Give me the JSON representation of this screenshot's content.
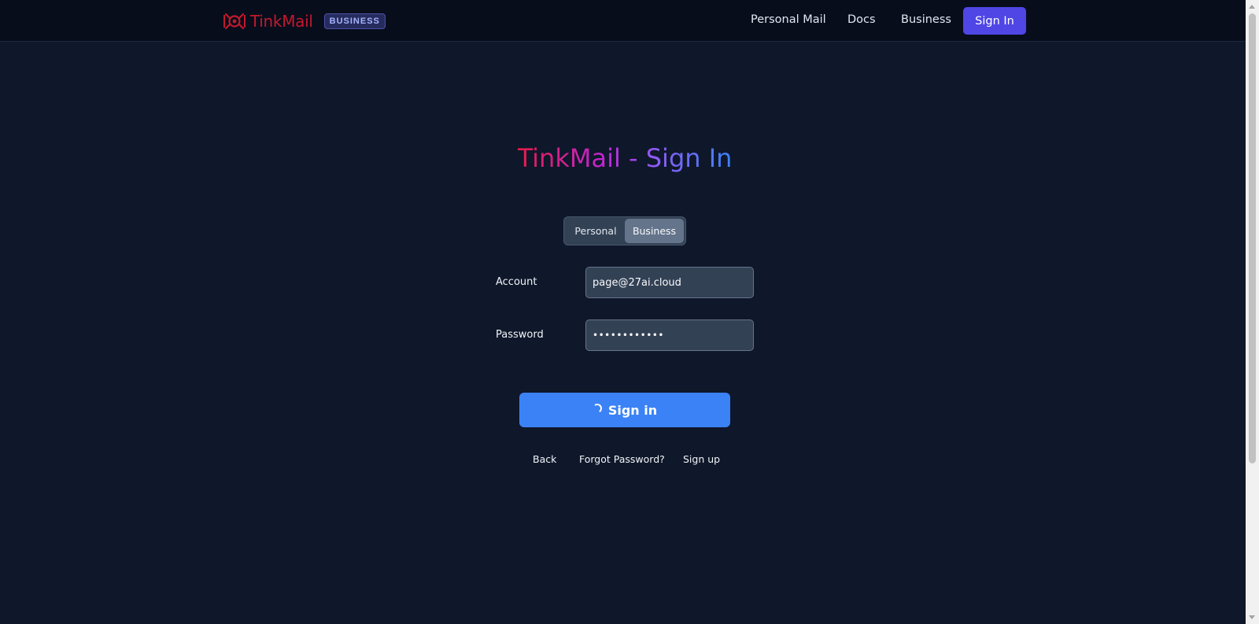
{
  "nav": {
    "brand_name": "TinkMail",
    "brand_badge": "BUSINESS",
    "links": [
      "Personal Mail",
      "Docs",
      "Business"
    ],
    "signin_label": "Sign In"
  },
  "colors": {
    "background": "#0f172a",
    "navbar": "#080d1c",
    "brand": "#c2192c",
    "accent": "#4f46e5",
    "primary_button": "#3b82f6"
  },
  "form": {
    "title": "TinkMail - Sign In",
    "account_types": [
      "Personal",
      "Business"
    ],
    "selected_account_type": "Business",
    "account_label": "Account",
    "account_value": "page@27ai.cloud",
    "password_label": "Password",
    "password_value": "••••••••••••",
    "submit_label": "Sign in",
    "submit_state": "loading-spinner-icon"
  },
  "footer_links": [
    "Back",
    "Forgot Password?",
    "Sign up"
  ]
}
